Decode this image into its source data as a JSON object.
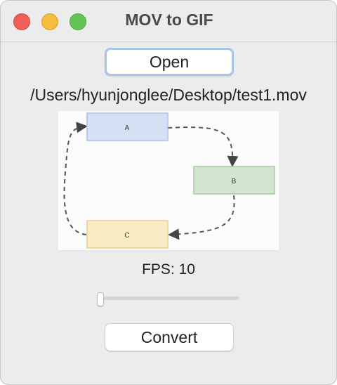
{
  "window": {
    "title": "MOV to GIF"
  },
  "controls": {
    "open_label": "Open",
    "file_path": "/Users/hyunjonglee/Desktop/test1.mov",
    "fps_label": "FPS: 10",
    "fps_value": 10,
    "convert_label": "Convert"
  },
  "preview": {
    "nodes": [
      {
        "label": "A",
        "fill": "#d6e0f5",
        "stroke": "#a9bfe6"
      },
      {
        "label": "B",
        "fill": "#d3e4d0",
        "stroke": "#a8c8a1"
      },
      {
        "label": "C",
        "fill": "#f9ebc4",
        "stroke": "#e6cf8c"
      }
    ]
  },
  "colors": {
    "traffic_close": "#ee5f57",
    "traffic_minimize": "#f5bd3f",
    "traffic_zoom": "#62c554",
    "focus_ring": "#a9c3ea"
  }
}
